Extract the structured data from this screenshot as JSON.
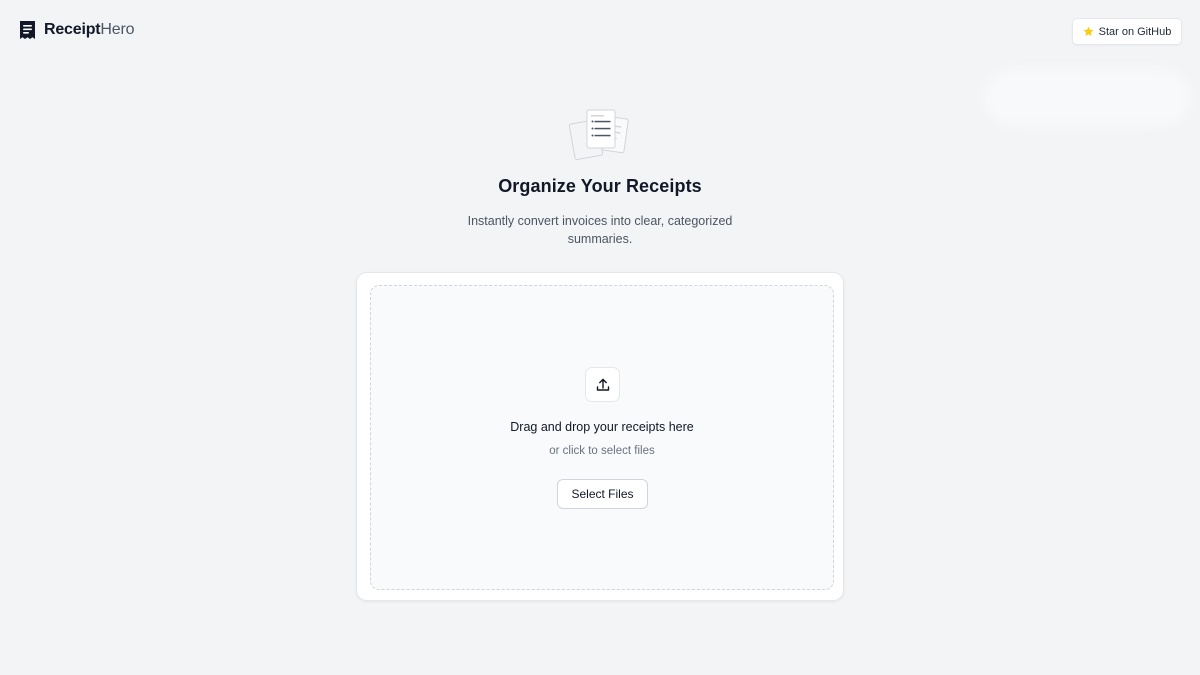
{
  "app": {
    "name_part1": "Receipt",
    "name_part2": "Hero"
  },
  "header": {
    "github_label": "Star on GitHub"
  },
  "hero": {
    "title": "Organize Your Receipts",
    "subtitle": "Instantly convert invoices into clear, categorized summaries."
  },
  "upload": {
    "drop_title": "Drag and drop your receipts here",
    "drop_subtitle": "or click to select files",
    "button_label": "Select Files"
  },
  "icons": {
    "logo": "receipt-icon",
    "github_star": "star-icon",
    "hero": "documents-illustration-icon",
    "upload": "upload-icon"
  },
  "colors": {
    "background": "#f3f4f6",
    "text_primary": "#111827",
    "text_secondary": "#6b7280",
    "star": "#facc15",
    "border": "#e5e7eb"
  }
}
